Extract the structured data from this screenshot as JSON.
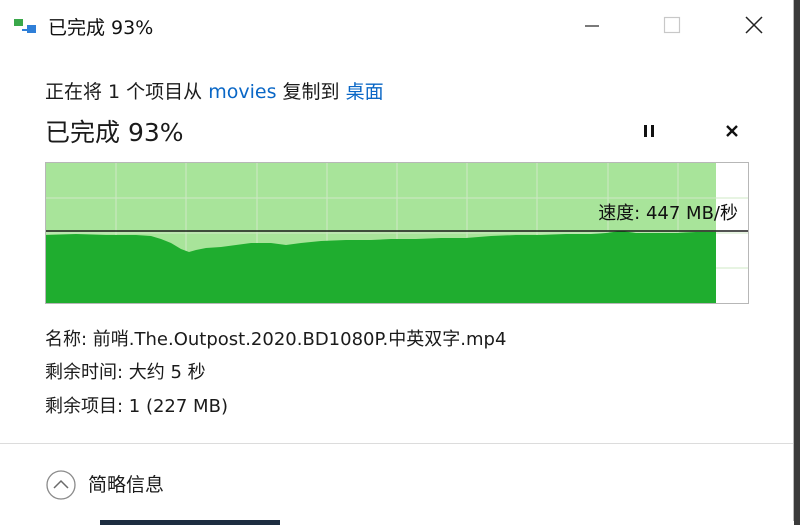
{
  "window": {
    "title": "已完成 93%"
  },
  "copy_line": {
    "prefix": "正在将 1 个项目从 ",
    "source": "movies",
    "middle": " 复制到 ",
    "destination": "桌面"
  },
  "status": {
    "headline": "已完成 93%",
    "percent_complete": 93,
    "speed_label": "速度: 447 MB/秒"
  },
  "details": {
    "name_line": "名称: 前哨.The.Outpost.2020.BD1080P.中英双字.mp4",
    "time_line": "剩余时间: 大约 5 秒",
    "items_line": "剩余项目: 1 (227 MB)"
  },
  "footer": {
    "more_label": "简略信息"
  },
  "colors": {
    "accent_link": "#0a67c6",
    "graph_fill": "#1fad2f",
    "graph_progress_bg": "#a8e49a",
    "graph_grid": "#cfe8c6"
  },
  "icons": {
    "app": "copy-files-icon",
    "minimize": "minimize-icon",
    "maximize": "maximize-icon",
    "close": "close-icon",
    "pause": "pause-icon",
    "cancel": "cancel-icon",
    "more": "chevron-up-circle-icon"
  }
}
